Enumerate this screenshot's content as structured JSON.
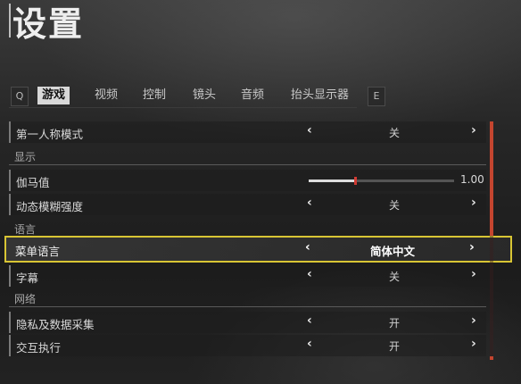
{
  "title": "设置",
  "tabs": {
    "prev_key": "Q",
    "next_key": "E",
    "items": [
      "游戏",
      "视频",
      "控制",
      "镜头",
      "音频",
      "抬头显示器"
    ],
    "active": "游戏"
  },
  "settings": {
    "first_person": {
      "label": "第一人称模式",
      "value": "关"
    },
    "section_display": "显示",
    "gamma": {
      "label": "伽马值",
      "value": "1.00",
      "level": 0.32
    },
    "motion_blur": {
      "label": "动态模糊强度",
      "value": "关"
    },
    "section_language": "语言",
    "menu_language": {
      "label": "菜单语言",
      "value": "简体中文"
    },
    "subtitles": {
      "label": "字幕",
      "value": "关"
    },
    "section_network": "网络",
    "privacy": {
      "label": "隐私及数据采集",
      "value": "开"
    },
    "crossplay": {
      "label": "交互执行",
      "value": "开"
    }
  },
  "arrows": {
    "left": "‹",
    "right": "›"
  },
  "colors": {
    "accent": "#c4452f",
    "highlight": "#d8c534"
  }
}
